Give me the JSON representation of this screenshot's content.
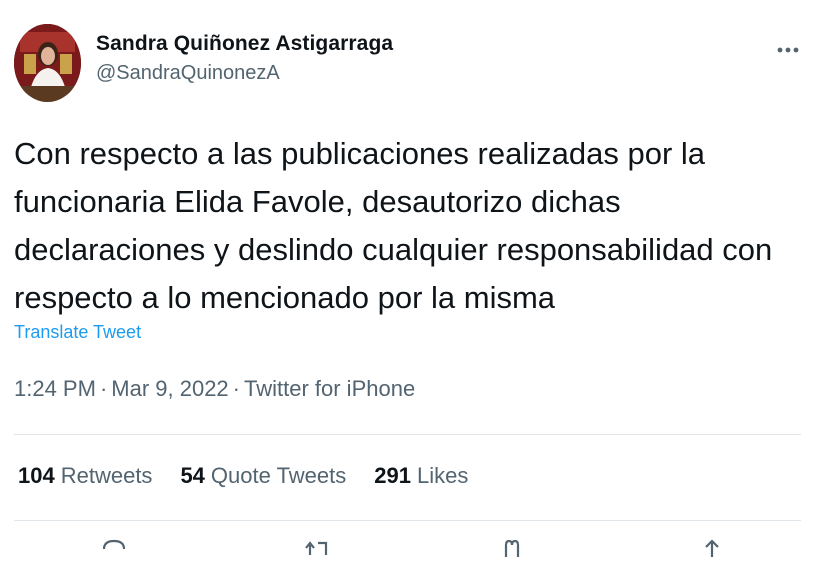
{
  "author": {
    "display_name": "Sandra Quiñonez Astigarraga",
    "handle": "@SandraQuinonezA"
  },
  "tweet": {
    "text": "Con respecto a las publicaciones realizadas por la funcionaria Elida Favole, desautorizo dichas declaraciones y deslindo cualquier responsabilidad con respecto a lo mencionado por la misma",
    "translate_label": "Translate Tweet",
    "time": "1:24 PM",
    "separator": "·",
    "date": "Mar 9, 2022",
    "source": "Twitter for iPhone"
  },
  "stats": {
    "retweets_count": "104",
    "retweets_label": "Retweets",
    "quotes_count": "54",
    "quotes_label": "Quote Tweets",
    "likes_count": "291",
    "likes_label": "Likes"
  },
  "icons": {
    "more": "more-horizontal-icon",
    "reply": "reply-icon",
    "retweet": "retweet-icon",
    "like": "heart-icon",
    "share": "share-icon"
  },
  "colors": {
    "link": "#1d9bf0",
    "text": "#0f1419",
    "secondary": "#536471",
    "divider": "#e1e6ea"
  }
}
